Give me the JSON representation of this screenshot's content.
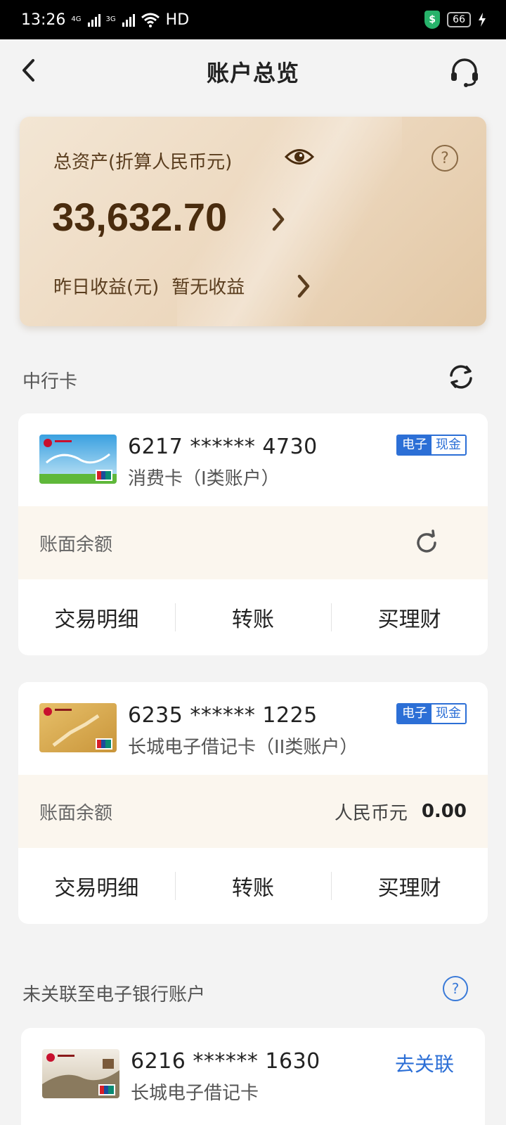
{
  "status_bar": {
    "time": "13:26",
    "network_1": "4G",
    "network_2": "3G",
    "hd": "HD",
    "battery": "66"
  },
  "header": {
    "title": "账户总览"
  },
  "assets": {
    "label": "总资产(折算人民币元)",
    "amount": "33,632.70",
    "yesterday_label": "昨日收益(元)",
    "yesterday_value": "暂无收益"
  },
  "section_boc": {
    "label": "中行卡"
  },
  "cards": [
    {
      "number": "6217 ****** 4730",
      "type": "消费卡（I类账户）",
      "badge_a": "电子",
      "badge_b": "现金",
      "balance_label": "账面余额",
      "actions": [
        "交易明细",
        "转账",
        "买理财"
      ]
    },
    {
      "number": "6235 ****** 1225",
      "type": "长城电子借记卡（II类账户）",
      "badge_a": "电子",
      "badge_b": "现金",
      "balance_label": "账面余额",
      "currency": "人民币元",
      "balance": "0.00",
      "actions": [
        "交易明细",
        "转账",
        "买理财"
      ]
    }
  ],
  "section_unlinked": {
    "label": "未关联至电子银行账户"
  },
  "unlinked_card": {
    "number": "6216 ****** 1630",
    "type": "长城电子借记卡",
    "link_label": "去关联"
  },
  "colors": {
    "accent": "#2c6fd6",
    "asset_text": "#4a2c0e"
  }
}
